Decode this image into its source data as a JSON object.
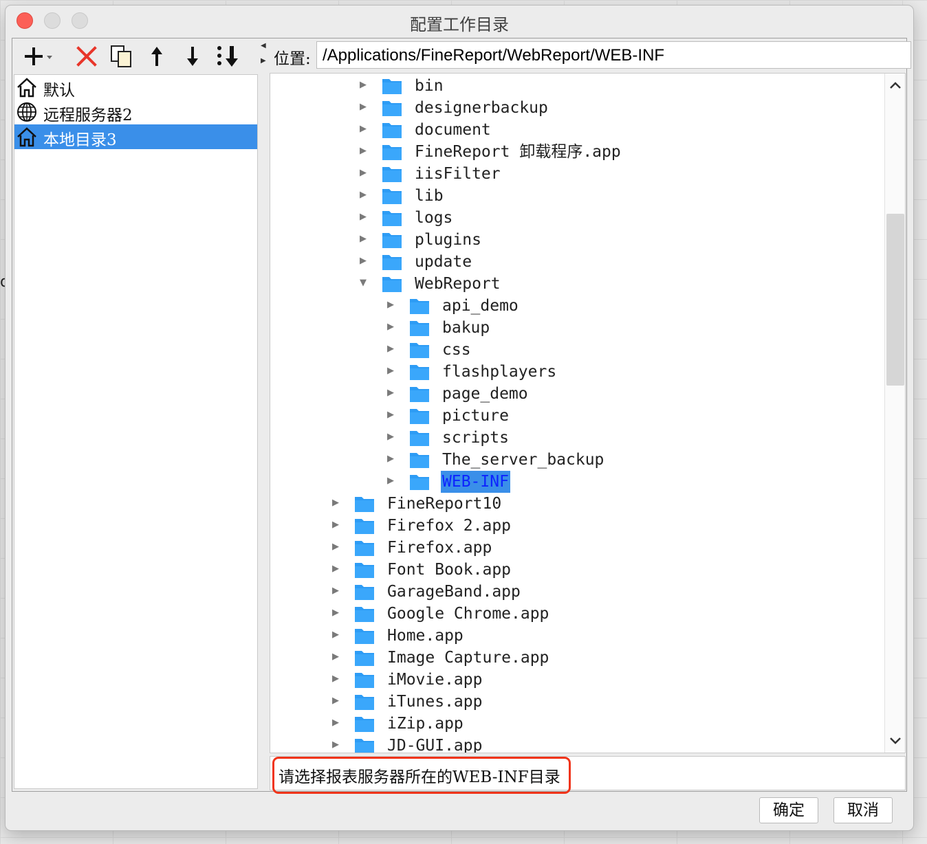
{
  "window": {
    "title": "配置工作目录"
  },
  "background": {
    "edge_letter": "d"
  },
  "toolbar": {
    "icons": [
      "add-dropdown-icon",
      "delete-icon",
      "copy-icon",
      "move-up-icon",
      "move-down-icon",
      "move-bottom-icon"
    ]
  },
  "servers": [
    {
      "label": "默认",
      "icon": "home-icon",
      "selected": false
    },
    {
      "label": "远程服务器2",
      "icon": "globe-icon",
      "selected": false
    },
    {
      "label": "本地目录3",
      "icon": "home-icon",
      "selected": true
    }
  ],
  "location": {
    "label": "位置:",
    "path": "/Applications/FineReport/WebReport/WEB-INF"
  },
  "tree": [
    {
      "label": "bin",
      "level": 2,
      "expanded": false
    },
    {
      "label": "designerbackup",
      "level": 2,
      "expanded": false
    },
    {
      "label": "document",
      "level": 2,
      "expanded": false
    },
    {
      "label": "FineReport 卸载程序.app",
      "level": 2,
      "expanded": false
    },
    {
      "label": "iisFilter",
      "level": 2,
      "expanded": false
    },
    {
      "label": "lib",
      "level": 2,
      "expanded": false
    },
    {
      "label": "logs",
      "level": 2,
      "expanded": false
    },
    {
      "label": "plugins",
      "level": 2,
      "expanded": false
    },
    {
      "label": "update",
      "level": 2,
      "expanded": false
    },
    {
      "label": "WebReport",
      "level": 2,
      "expanded": true
    },
    {
      "label": "api_demo",
      "level": 3,
      "expanded": false
    },
    {
      "label": "bakup",
      "level": 3,
      "expanded": false
    },
    {
      "label": "css",
      "level": 3,
      "expanded": false
    },
    {
      "label": "flashplayers",
      "level": 3,
      "expanded": false
    },
    {
      "label": "page_demo",
      "level": 3,
      "expanded": false
    },
    {
      "label": "picture",
      "level": 3,
      "expanded": false
    },
    {
      "label": "scripts",
      "level": 3,
      "expanded": false
    },
    {
      "label": "The_server_backup",
      "level": 3,
      "expanded": false
    },
    {
      "label": "WEB-INF",
      "level": 3,
      "expanded": false,
      "selected": true
    },
    {
      "label": "FineReport10",
      "level": 1,
      "expanded": false
    },
    {
      "label": "Firefox 2.app",
      "level": 1,
      "expanded": false
    },
    {
      "label": "Firefox.app",
      "level": 1,
      "expanded": false
    },
    {
      "label": "Font Book.app",
      "level": 1,
      "expanded": false
    },
    {
      "label": "GarageBand.app",
      "level": 1,
      "expanded": false
    },
    {
      "label": "Google Chrome.app",
      "level": 1,
      "expanded": false
    },
    {
      "label": "Home.app",
      "level": 1,
      "expanded": false
    },
    {
      "label": "Image Capture.app",
      "level": 1,
      "expanded": false
    },
    {
      "label": "iMovie.app",
      "level": 1,
      "expanded": false
    },
    {
      "label": "iTunes.app",
      "level": 1,
      "expanded": false
    },
    {
      "label": "iZip.app",
      "level": 1,
      "expanded": false
    },
    {
      "label": "JD-GUI.app",
      "level": 1,
      "expanded": false
    }
  ],
  "hint": {
    "text": "请选择报表服务器所在的WEB-INF目录"
  },
  "buttons": {
    "ok": "确定",
    "cancel": "取消"
  },
  "colors": {
    "selection": "#3a8fe9",
    "folder": "#2d9cf5",
    "close": "#fc5f57",
    "delete": "#e8362a",
    "highlight_border": "#f0341a"
  }
}
